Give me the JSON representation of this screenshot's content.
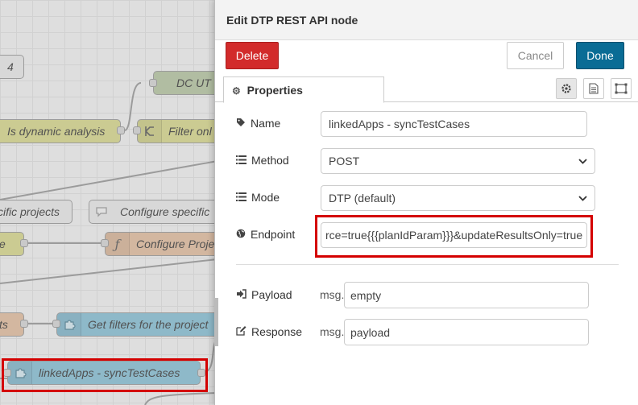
{
  "canvas": {
    "nodes": [
      {
        "label": "4"
      },
      {
        "label": "DC UT"
      },
      {
        "label": "Is dynamic analysis"
      },
      {
        "label": "Filter onl"
      },
      {
        "label": "cific projects"
      },
      {
        "label": "Configure specific"
      },
      {
        "label": "e"
      },
      {
        "label": "Configure Proje"
      },
      {
        "label": "ts"
      },
      {
        "label": "Get filters for the project"
      },
      {
        "label": "linkedApps - syncTestCases"
      }
    ]
  },
  "tray": {
    "title": "Edit DTP REST API node",
    "buttons": {
      "delete": "Delete",
      "cancel": "Cancel",
      "done": "Done"
    },
    "tab": {
      "label": "Properties"
    },
    "fields": {
      "name": {
        "label": "Name",
        "value": "linkedApps - syncTestCases"
      },
      "method": {
        "label": "Method",
        "value": "POST"
      },
      "mode": {
        "label": "Mode",
        "value": "DTP (default)"
      },
      "endpoint": {
        "label": "Endpoint",
        "value": "rce=true{{{planIdParam}}}&updateResultsOnly=true"
      },
      "payload": {
        "label": "Payload",
        "prefix": "msg.",
        "value": "empty"
      },
      "response": {
        "label": "Response",
        "prefix": "msg.",
        "value": "payload"
      }
    }
  },
  "colors": {
    "delete": "#d22b2b",
    "done": "#0a6c95",
    "highlight": "#d40000",
    "node_olive": "#dcdc8c",
    "node_green": "#b8c8a2",
    "node_orange": "#e7c0a0",
    "node_blue": "#87c2d8",
    "node_grey": "#eeeeee"
  }
}
